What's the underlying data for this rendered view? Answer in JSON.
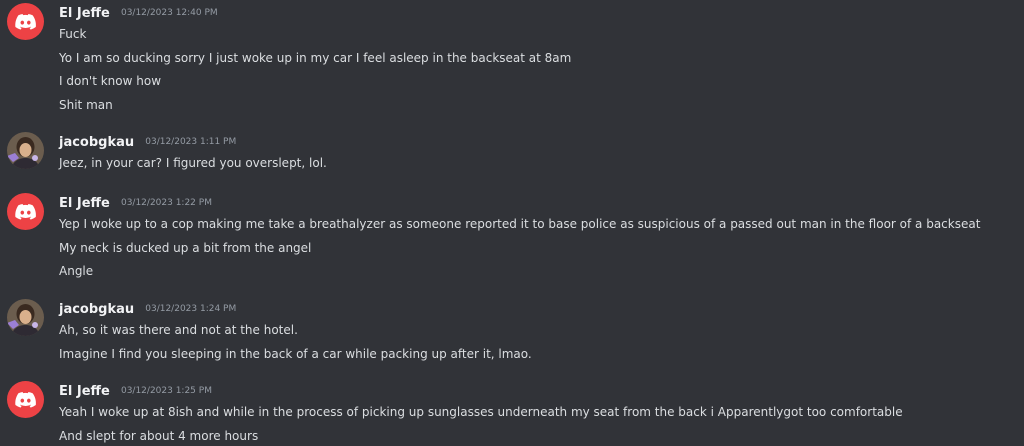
{
  "messages": [
    {
      "username": "El Jeffe",
      "timestamp": "03/12/2023 12:40 PM",
      "avatar": "discord-logo-icon",
      "lines": [
        "Fuck",
        "Yo I am so ducking sorry I just woke up in my car I feel asleep in the backseat at 8am",
        "I don't know how",
        "Shit man"
      ]
    },
    {
      "username": "jacobgkau",
      "timestamp": "03/12/2023 1:11 PM",
      "avatar": "user-photo-avatar",
      "lines": [
        "Jeez, in your car? I figured you overslept, lol."
      ]
    },
    {
      "username": "El Jeffe",
      "timestamp": "03/12/2023 1:22 PM",
      "avatar": "discord-logo-icon",
      "lines": [
        "Yep I woke up to a cop making me take a breathalyzer as someone reported it to base police as suspicious of a passed out man in the floor of a backseat",
        "My neck is ducked up a bit from the angel",
        "Angle"
      ]
    },
    {
      "username": "jacobgkau",
      "timestamp": "03/12/2023 1:24 PM",
      "avatar": "user-photo-avatar",
      "lines": [
        "Ah, so it was there and not at the hotel.",
        "Imagine I find you sleeping in the back of a car while packing up after it, lmao."
      ]
    },
    {
      "username": "El Jeffe",
      "timestamp": "03/12/2023 1:25 PM",
      "avatar": "discord-logo-icon",
      "lines": [
        "Yeah I woke up at 8ish and while in the process of picking up sunglasses underneath my seat from the back i Apparentlygot too comfortable",
        "And slept for about 4 more hours"
      ]
    }
  ],
  "colors": {
    "background": "#313338",
    "username": "#f2f3f5",
    "timestamp": "#949ba4",
    "message_text": "#dbdee1",
    "discord_avatar": "#ed4245"
  }
}
